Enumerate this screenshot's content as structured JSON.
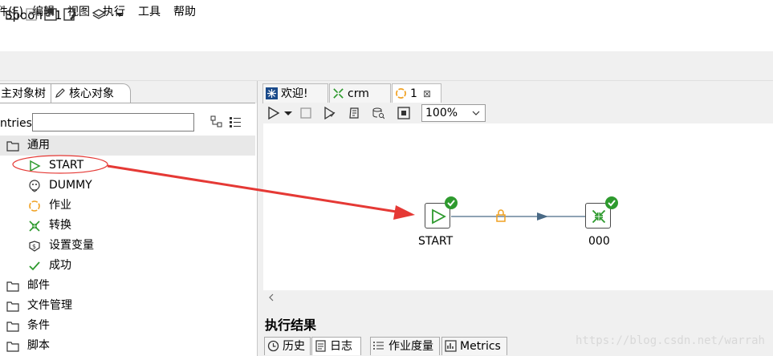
{
  "window": {
    "title": "Spoon - 1"
  },
  "menu": {
    "items": [
      "件(F)",
      "编辑",
      "视图",
      "执行",
      "工具",
      "帮助"
    ]
  },
  "left": {
    "tabs": [
      "主对象树",
      "核心对象"
    ],
    "entries_label": "ntries",
    "search_value": "",
    "tree": [
      {
        "label": "通用",
        "icon": "folder-icon",
        "level": 0
      },
      {
        "label": "START",
        "icon": "start-icon",
        "level": 1
      },
      {
        "label": "DUMMY",
        "icon": "dummy-icon",
        "level": 1
      },
      {
        "label": "作业",
        "icon": "job-icon",
        "level": 1
      },
      {
        "label": "转换",
        "icon": "transform-icon",
        "level": 1
      },
      {
        "label": "设置变量",
        "icon": "set-variable-icon",
        "level": 1
      },
      {
        "label": "成功",
        "icon": "success-icon",
        "level": 1
      },
      {
        "label": "邮件",
        "icon": "folder-icon",
        "level": 0
      },
      {
        "label": "文件管理",
        "icon": "folder-icon",
        "level": 0
      },
      {
        "label": "条件",
        "icon": "folder-icon",
        "level": 0
      },
      {
        "label": "脚本",
        "icon": "folder-icon",
        "level": 0
      }
    ]
  },
  "right": {
    "tabs": [
      {
        "label": "欢迎!",
        "icon": "welcome-icon"
      },
      {
        "label": "crm",
        "icon": "transform-icon"
      },
      {
        "label": "1",
        "icon": "job-icon",
        "close": "⊠"
      }
    ],
    "zoom": "100%",
    "canvas": {
      "nodes": [
        {
          "label": "START",
          "icon": "start-icon"
        },
        {
          "label": "000",
          "icon": "transform-icon"
        }
      ]
    },
    "results_title": "执行结果",
    "bottom_tabs": [
      "历史",
      "日志",
      "作业度量",
      "Metrics"
    ],
    "watermark": "https://blog.csdn.net/warrah"
  },
  "colors": {
    "accent_green": "#2e9a2e",
    "arrow_red": "#e53935",
    "hop_blue": "#4a6a86",
    "lock_orange": "#f0a020"
  }
}
